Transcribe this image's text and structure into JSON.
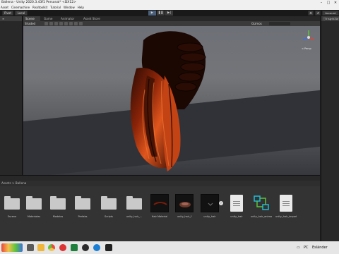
{
  "window": {
    "title": "Ballena - Unity 2020.3.43f1 Personal* <DX12>",
    "min": "–",
    "max": "□",
    "close": "✕"
  },
  "menu": [
    "Asset",
    "Cinemachine",
    "Realtoolkit",
    "Tutorial",
    "Window",
    "Help"
  ],
  "toolbar": {
    "pivot": "Pivot",
    "local": "Local",
    "account": "Account"
  },
  "hierarchy": {
    "tab_label": ""
  },
  "scene_tabs": [
    "Scene",
    "Game",
    "Animator",
    "Asset Store"
  ],
  "scene_toolbar": {
    "shading": "Shaded",
    "gizmos": "Gizmos",
    "persp_label": "< Persp"
  },
  "inspector": {
    "tab_label": "Inspector"
  },
  "project": {
    "path": "Assets > Ballena",
    "assets": [
      {
        "label": "Escena",
        "kind": "folder"
      },
      {
        "label": "Materiales",
        "kind": "folder"
      },
      {
        "label": "Modelos",
        "kind": "folder"
      },
      {
        "label": "Prefabs",
        "kind": "folder"
      },
      {
        "label": "Scripts",
        "kind": "folder"
      },
      {
        "label": "unity_hair_...",
        "kind": "folder"
      },
      {
        "label": "Hair Material",
        "kind": "dark"
      },
      {
        "label": "unity_hair_f",
        "kind": "dark"
      },
      {
        "label": "unity_hair",
        "kind": "dark"
      },
      {
        "label": "unity_hair",
        "kind": "doc"
      },
      {
        "label": "unity_hair_animat...",
        "kind": "graph"
      },
      {
        "label": "unity_hair_import...",
        "kind": "doc"
      }
    ]
  },
  "taskbar": {
    "user": "PC",
    "language": "Esländer"
  },
  "colors": {
    "hair_orange": "#e0561d",
    "panel": "#282828",
    "accent_cyan": "#1fbad6",
    "gizmo_green": "#5bc43c",
    "gizmo_red": "#d9473a"
  }
}
